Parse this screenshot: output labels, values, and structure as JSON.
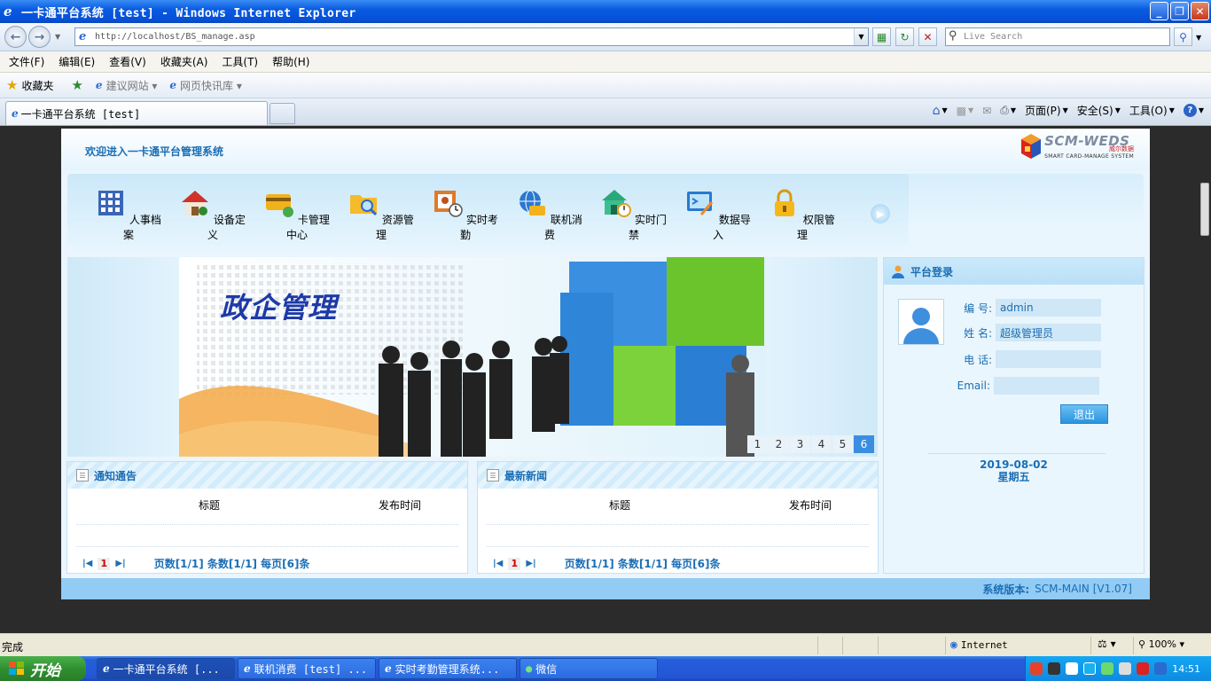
{
  "window": {
    "title": "一卡通平台系统 [test] - Windows Internet Explorer",
    "buttons": [
      "_",
      "❐",
      "✕"
    ]
  },
  "addressbar": {
    "url": "http://localhost/BS_manage.asp",
    "search_placeholder": "Live Search"
  },
  "menu": [
    "文件(F)",
    "编辑(E)",
    "查看(V)",
    "收藏夹(A)",
    "工具(T)",
    "帮助(H)"
  ],
  "favorites": {
    "label": "收藏夹",
    "items": [
      "建议网站 ▾",
      "网页快讯库 ▾"
    ]
  },
  "tabs": {
    "active": "一卡通平台系统 [test]"
  },
  "commandbar": {
    "page": "页面(P)",
    "safety": "安全(S)",
    "tools": "工具(O)"
  },
  "app": {
    "welcome": "欢迎进入一卡通平台管理系统",
    "brand_big": "SCM-WEDS",
    "brand_cn": "威尔数据",
    "brand_small": "SMART CARD-MANAGE SYSTEM",
    "nav": [
      {
        "label": "人事档案",
        "icon": "personnel-file-icon"
      },
      {
        "label": "设备定义",
        "icon": "device-house-icon"
      },
      {
        "label": "卡管理中心",
        "icon": "card-center-icon"
      },
      {
        "label": "资源管理",
        "icon": "folder-search-icon"
      },
      {
        "label": "实时考勤",
        "icon": "attendance-clock-icon"
      },
      {
        "label": "联机消费",
        "icon": "globe-card-icon"
      },
      {
        "label": "实时门禁",
        "icon": "door-clock-icon"
      },
      {
        "label": "数据导入",
        "icon": "import-icon"
      },
      {
        "label": "权限管理",
        "icon": "lock-icon"
      }
    ],
    "banner": {
      "title": "政企管理",
      "pages": [
        "1",
        "2",
        "3",
        "4",
        "5",
        "6"
      ],
      "active_page": "6"
    },
    "notice": {
      "title": "通知通告",
      "col_title": "标题",
      "col_time": "发布时间",
      "current_page": "1",
      "info": "页数[1/1] 条数[1/1] 每页[6]条"
    },
    "news": {
      "title": "最新新闻",
      "col_title": "标题",
      "col_time": "发布时间",
      "current_page": "1",
      "info": "页数[1/1] 条数[1/1] 每页[6]条"
    },
    "login": {
      "title": "平台登录",
      "id_label": "编  号:",
      "id_value": "admin",
      "name_label": "姓  名:",
      "name_value": "超级管理员",
      "phone_label": "电  话:",
      "phone_value": "",
      "email_label": "Email:",
      "email_value": "",
      "logout": "退出",
      "date": "2019-08-02",
      "weekday": "星期五"
    },
    "footer_label": "系统版本:",
    "footer_value": "SCM-MAIN [V1.07]"
  },
  "status": {
    "text": "完成",
    "zone": "Internet",
    "zoom": "100%"
  },
  "taskbar": {
    "start": "开始",
    "tasks": [
      "一卡通平台系统 [...",
      "联机消费 [test] ...",
      "实时考勤管理系统...",
      "微信"
    ],
    "clock": "14:51"
  }
}
